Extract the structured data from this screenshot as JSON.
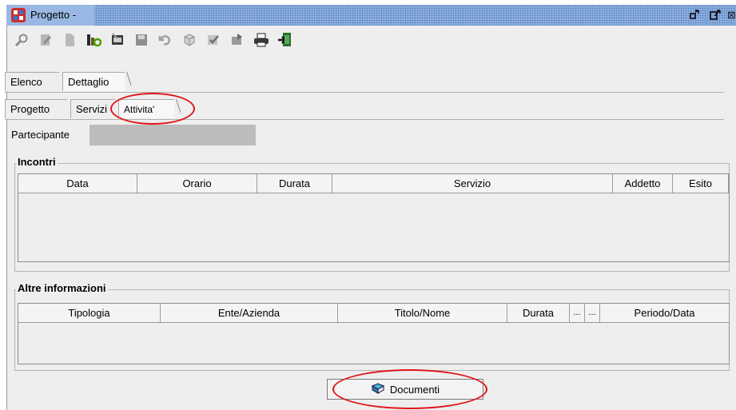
{
  "window": {
    "title": "Progetto -",
    "titlebar_color": "#8fb1e0",
    "app_icon": "app-logo-icon",
    "controls": [
      "restore-icon",
      "maximize-icon",
      "close-icon"
    ]
  },
  "toolbar": {
    "icons": [
      "search-icon",
      "edit-icon",
      "new-document-icon",
      "filter-icon",
      "edit-record-icon",
      "save-icon",
      "undo-icon",
      "refresh-icon",
      "select-icon",
      "move-icon",
      "print-icon",
      "exit-icon"
    ]
  },
  "tabs_main": [
    {
      "label": "Elenco",
      "active": false
    },
    {
      "label": "Dettaglio",
      "active": true
    }
  ],
  "tabs_sub": [
    {
      "label": "Progetto",
      "active": false
    },
    {
      "label": "Servizi",
      "active": false
    },
    {
      "label": "Attivita'",
      "active": true
    }
  ],
  "participant": {
    "label": "Partecipante",
    "value": ""
  },
  "incontri": {
    "legend": "Incontri",
    "columns": [
      "Data",
      "Orario",
      "Durata",
      "Servizio",
      "Addetto",
      "Esito"
    ],
    "rows": []
  },
  "altre": {
    "legend": "Altre informazioni",
    "columns": [
      "Tipologia",
      "Ente/Azienda",
      "Titolo/Nome",
      "Durata",
      "...",
      "...",
      "Periodo/Data"
    ],
    "rows": []
  },
  "documenti_button": {
    "label": "Documenti",
    "icon": "book-icon"
  },
  "highlight_color": "#e0161a"
}
